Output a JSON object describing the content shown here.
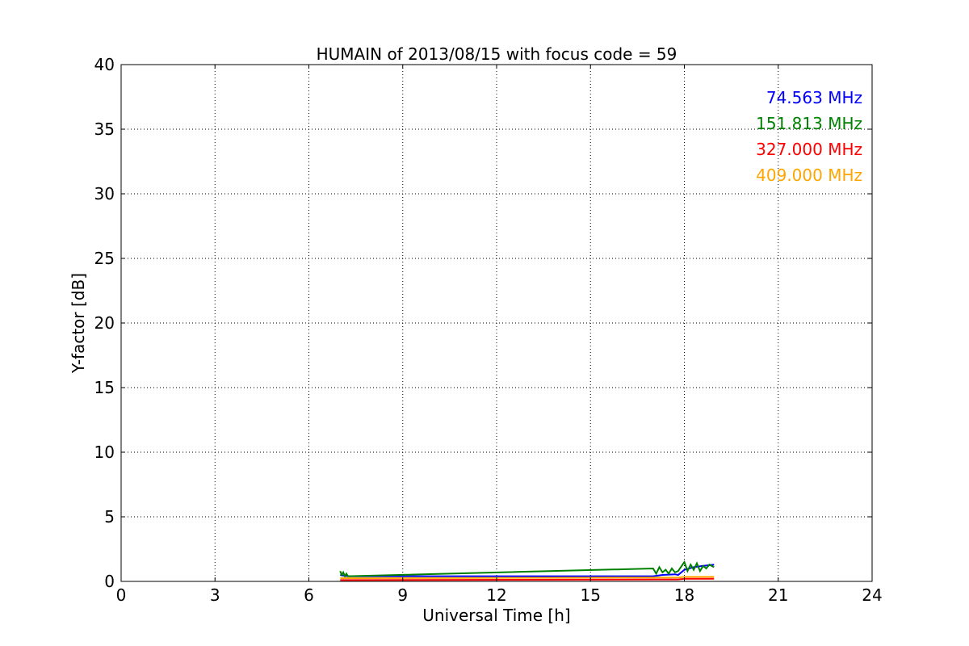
{
  "chart_data": {
    "type": "line",
    "title": "HUMAIN of 2013/08/15 with focus code = 59",
    "xlabel": "Universal Time [h]",
    "ylabel": "Y-factor [dB]",
    "xlim": [
      0,
      24
    ],
    "ylim": [
      0,
      40
    ],
    "xticks": [
      0,
      3,
      6,
      9,
      12,
      15,
      18,
      21,
      24
    ],
    "yticks": [
      0,
      5,
      10,
      15,
      20,
      25,
      30,
      35,
      40
    ],
    "grid": true,
    "legend_placement": "top-right",
    "series": [
      {
        "name": "74.563 MHz",
        "color": "#0000ff",
        "x": [
          7.0,
          7.1,
          7.25,
          17.0,
          17.3,
          17.7,
          17.8,
          18.0,
          18.3,
          18.6,
          18.95
        ],
        "y": [
          0.5,
          0.45,
          0.4,
          0.4,
          0.5,
          0.55,
          0.5,
          0.9,
          1.1,
          1.2,
          1.3
        ]
      },
      {
        "name": "151.813 MHz",
        "color": "#008000",
        "x": [
          7.0,
          7.05,
          7.1,
          7.15,
          7.2,
          7.25,
          17.0,
          17.1,
          17.2,
          17.3,
          17.4,
          17.5,
          17.6,
          17.7,
          17.8,
          18.0,
          18.1,
          18.2,
          18.3,
          18.4,
          18.5,
          18.6,
          18.7,
          18.8,
          18.95
        ],
        "y": [
          0.8,
          0.5,
          0.7,
          0.4,
          0.6,
          0.4,
          1.0,
          0.6,
          1.1,
          0.7,
          0.9,
          0.6,
          1.0,
          0.7,
          0.8,
          1.5,
          0.8,
          1.3,
          0.9,
          1.4,
          0.8,
          1.2,
          1.0,
          1.3,
          1.1
        ]
      },
      {
        "name": "327.000 MHz",
        "color": "#ff0000",
        "x": [
          7.0,
          7.25,
          17.0,
          17.8,
          18.0,
          18.95
        ],
        "y": [
          0.1,
          0.1,
          0.15,
          0.15,
          0.2,
          0.2
        ]
      },
      {
        "name": "409.000 MHz",
        "color": "#ffa500",
        "x": [
          7.0,
          7.25,
          17.0,
          17.8,
          18.0,
          18.95
        ],
        "y": [
          0.25,
          0.25,
          0.3,
          0.3,
          0.35,
          0.35
        ]
      }
    ]
  }
}
